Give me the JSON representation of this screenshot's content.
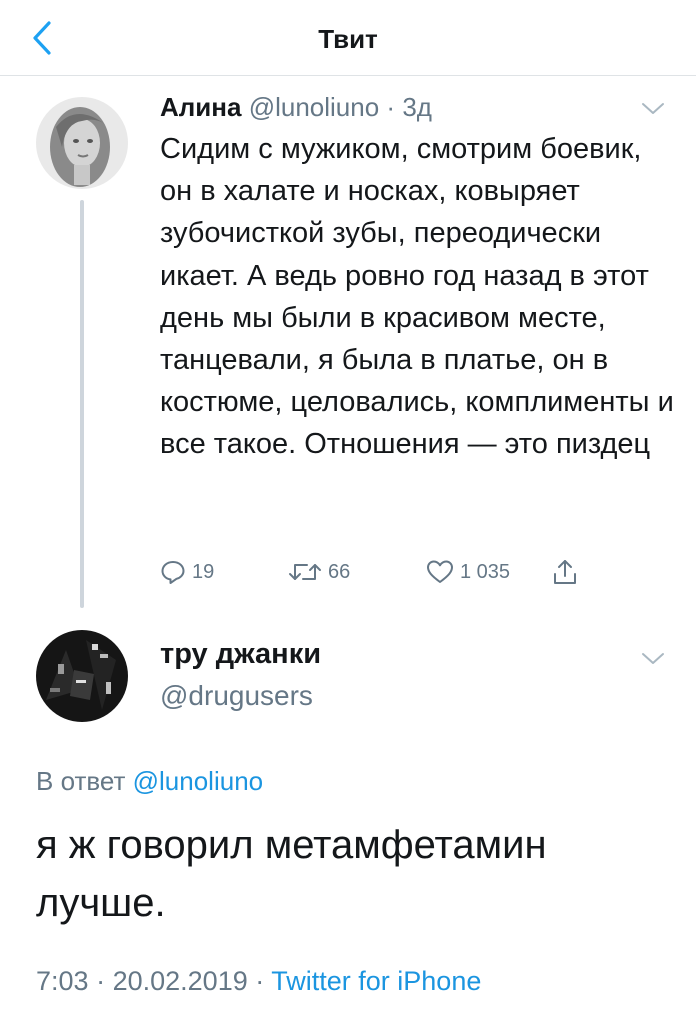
{
  "header": {
    "title": "Твит",
    "back_icon": "chevron-left-icon",
    "accent": "#1da1f2"
  },
  "tweet": {
    "author_name": "Алина",
    "handle": "@lunoliuno",
    "separator": "·",
    "time": "3д",
    "text": "Сидим с мужиком, смотрим боевик, он в халате и носках, ковыряет зубочисткой зубы, переодически икает. А ведь ровно год назад в этот день мы были в красивом месте, танцевали, я была в платье, он в костюме, целовались, комплименты и все такое. Отношения — это пиздец",
    "replies": "19",
    "retweets": "66",
    "likes": "1 035"
  },
  "reply": {
    "author_name": "тру джанки",
    "handle": "@drugusers",
    "reply_prefix": "В ответ",
    "reply_mention": "@lunoliuno",
    "text": "я ж говорил метамфетамин лучше.",
    "time": "7:03",
    "separator": "·",
    "date": "20.02.2019",
    "source": "Twitter for iPhone"
  },
  "colors": {
    "secondary_text": "#657786",
    "link": "#1b95e0",
    "divider": "#dfe3e6"
  }
}
